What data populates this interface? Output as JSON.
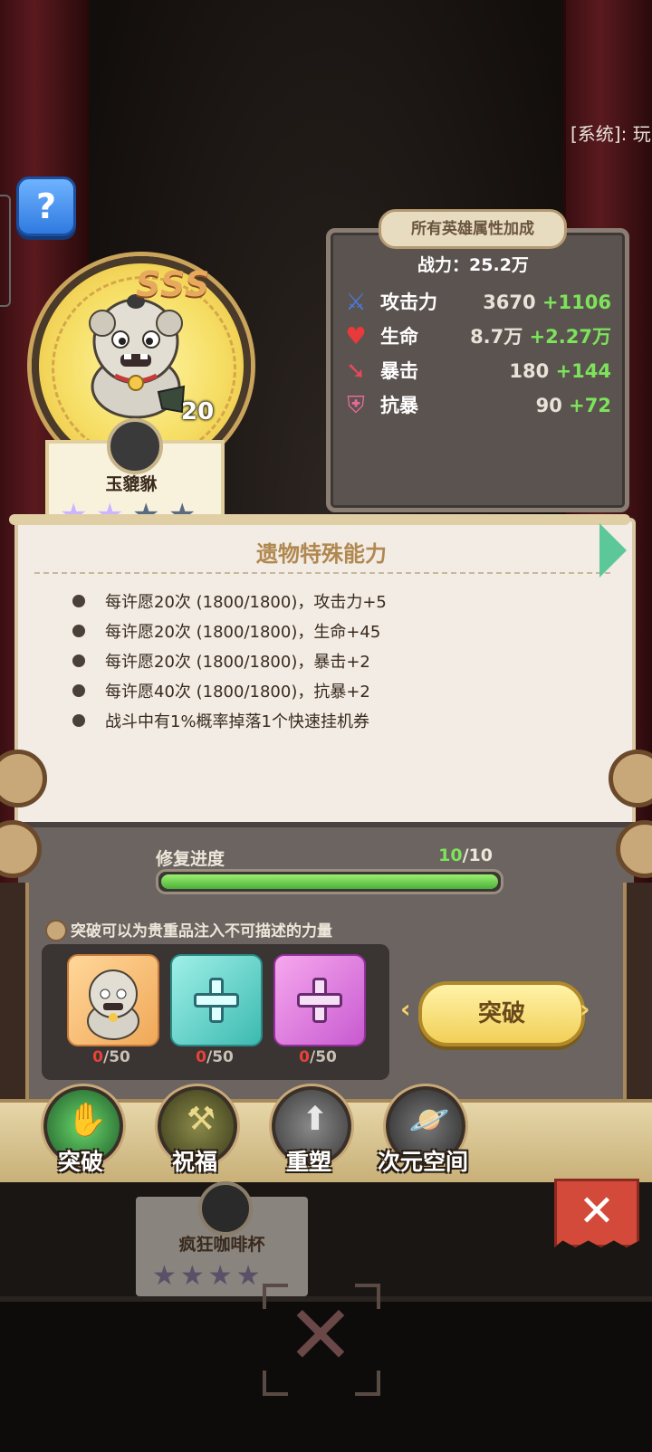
{
  "system_message": "[系统]: 玩",
  "hero": {
    "rank": "SSS",
    "level": "20",
    "name": "玉貔貅",
    "stars_total": 4,
    "stars_filled": 2
  },
  "stats": {
    "title": "所有英雄属性加成",
    "power": "战力：25.2万",
    "rows": [
      {
        "icon": "sword-icon",
        "label": "攻击力",
        "base": "3670",
        "bonus": "+1106"
      },
      {
        "icon": "heart-icon",
        "label": "生命",
        "base": "8.7万",
        "bonus": "+2.27万"
      },
      {
        "icon": "crit-arrow-icon",
        "label": "暴击",
        "base": "180",
        "bonus": "+144"
      },
      {
        "icon": "shield-icon",
        "label": "抗暴",
        "base": "90",
        "bonus": "+72"
      }
    ]
  },
  "ability": {
    "title": "遗物特殊能力",
    "items": [
      "每许愿20次 (1800/1800)，攻击力+5",
      "每许愿20次 (1800/1800)，生命+45",
      "每许愿20次 (1800/1800)，暴击+2",
      "每许愿40次 (1800/1800)，抗暴+2",
      "战斗中有1%概率掉落1个快速挂机券"
    ]
  },
  "repair": {
    "label": "修复进度",
    "current": "10",
    "max": "/10",
    "progress": 1.0
  },
  "breakthrough": {
    "hint": "突破可以为贵重品注入不可描述的力量",
    "materials": [
      {
        "icon": "mascot-icon",
        "current": "0",
        "max": "/50"
      },
      {
        "icon": "teal-plus-icon",
        "current": "0",
        "max": "/50"
      },
      {
        "icon": "pink-plus-icon",
        "current": "0",
        "max": "/50"
      }
    ],
    "button_label": "突破"
  },
  "tabs": [
    {
      "label": "突破",
      "icon": "claw-icon",
      "color": "#2e7a3a"
    },
    {
      "label": "祝福",
      "icon": "hammer-icon",
      "color": "#6a6a2a"
    },
    {
      "label": "重塑",
      "icon": "arrow-up-icon",
      "color": "#555555"
    },
    {
      "label": "次元空间",
      "icon": "planet-icon",
      "color": "#444444"
    }
  ],
  "background_card": {
    "name": "疯狂咖啡杯"
  },
  "colors": {
    "bonus_green": "#7de35a",
    "progress_green": "#4cb03a",
    "accent_gold": "#f2cf58",
    "close_red": "#d44a3a"
  }
}
